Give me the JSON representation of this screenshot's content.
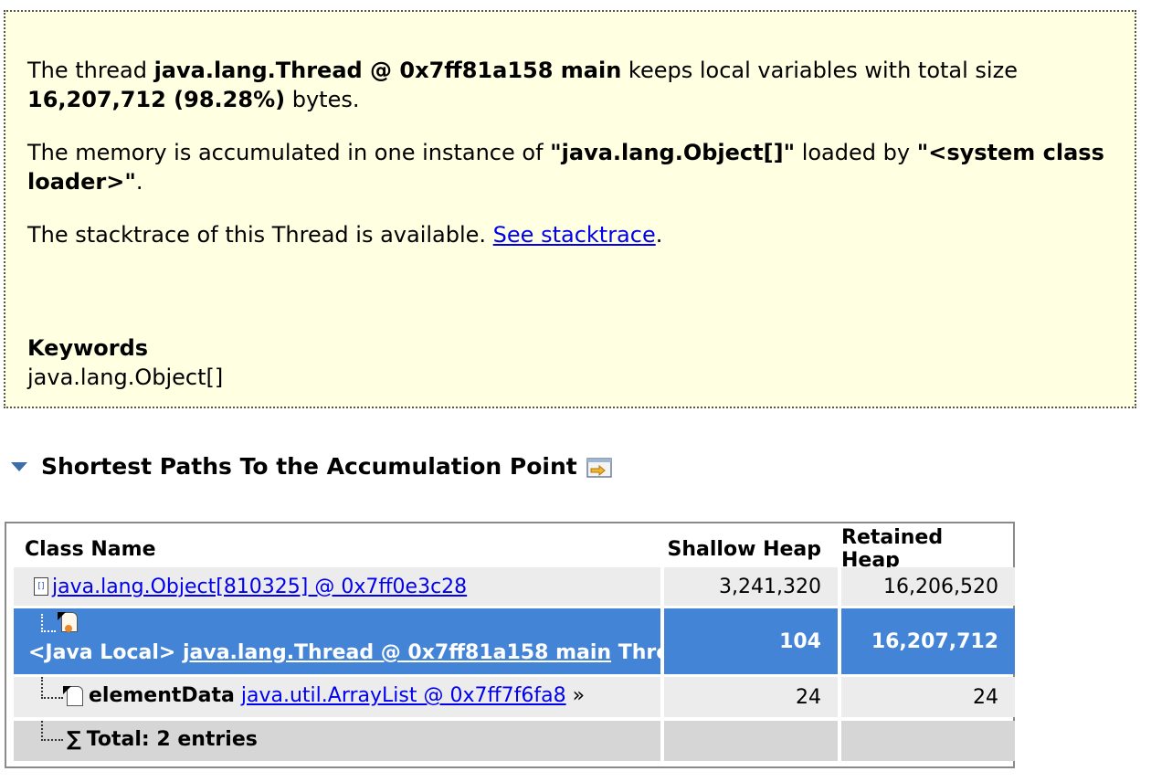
{
  "description": {
    "p1_pre": "The thread ",
    "p1_thread": "java.lang.Thread @ 0x7ff81a158 main",
    "p1_mid": " keeps local variables with total size ",
    "p1_size": "16,207,712 (98.28%)",
    "p1_post": " bytes.",
    "p2_pre": "The memory is accumulated in one instance of ",
    "p2_class": "\"java.lang.Object[]\"",
    "p2_mid": " loaded by ",
    "p2_loader": "\"<system class loader>\"",
    "p2_post": ".",
    "p3_pre": "The stacktrace of this Thread is available. ",
    "p3_link": "See stacktrace",
    "p3_post": ".",
    "keywords_title": "Keywords",
    "keywords_value": "java.lang.Object[]"
  },
  "section": {
    "title": "Shortest Paths To the Accumulation Point",
    "toggle_icon": "triangle-down-icon",
    "action_icon": "export-icon"
  },
  "table": {
    "columns": [
      "Class Name",
      "Shallow Heap",
      "Retained Heap"
    ],
    "rows": [
      {
        "link": "java.lang.Object[810325] @ 0x7ff0e3c28",
        "shallow": "3,241,320",
        "retained": "16,206,520"
      },
      {
        "prefix": "<Java Local> ",
        "link": "java.lang.Thread @ 0x7ff81a158 main",
        "suffix": " Thread",
        "shallow": "104",
        "retained": "16,207,712"
      },
      {
        "field": "elementData",
        "link": "java.util.ArrayList @ 0x7ff7f6fa8",
        "suffix": " »",
        "shallow": "24",
        "retained": "24"
      },
      {
        "total": "Total: 2 entries"
      }
    ],
    "selected_row_color": "#4384d6"
  }
}
